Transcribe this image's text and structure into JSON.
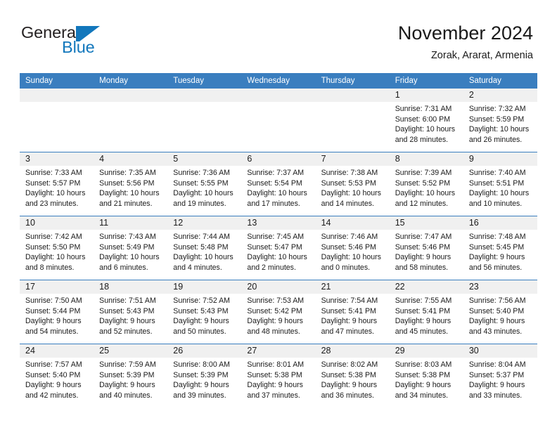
{
  "brand": {
    "name_part1": "General",
    "name_part2": "Blue",
    "accent_color": "#1277bc"
  },
  "header": {
    "title": "November 2024",
    "subtitle": "Zorak, Ararat, Armenia"
  },
  "theme": {
    "header_blue": "#3a7ebf",
    "date_band_grey": "#f0f0f0",
    "text_color": "#1a1a1a"
  },
  "weekdays": [
    "Sunday",
    "Monday",
    "Tuesday",
    "Wednesday",
    "Thursday",
    "Friday",
    "Saturday"
  ],
  "weeks": [
    [
      {
        "day": "",
        "sunrise": "",
        "sunset": "",
        "daylight_line1": "",
        "daylight_line2": "",
        "empty": true
      },
      {
        "day": "",
        "sunrise": "",
        "sunset": "",
        "daylight_line1": "",
        "daylight_line2": "",
        "empty": true
      },
      {
        "day": "",
        "sunrise": "",
        "sunset": "",
        "daylight_line1": "",
        "daylight_line2": "",
        "empty": true
      },
      {
        "day": "",
        "sunrise": "",
        "sunset": "",
        "daylight_line1": "",
        "daylight_line2": "",
        "empty": true
      },
      {
        "day": "",
        "sunrise": "",
        "sunset": "",
        "daylight_line1": "",
        "daylight_line2": "",
        "empty": true
      },
      {
        "day": "1",
        "sunrise": "Sunrise: 7:31 AM",
        "sunset": "Sunset: 6:00 PM",
        "daylight_line1": "Daylight: 10 hours",
        "daylight_line2": "and 28 minutes.",
        "empty": false
      },
      {
        "day": "2",
        "sunrise": "Sunrise: 7:32 AM",
        "sunset": "Sunset: 5:59 PM",
        "daylight_line1": "Daylight: 10 hours",
        "daylight_line2": "and 26 minutes.",
        "empty": false
      }
    ],
    [
      {
        "day": "3",
        "sunrise": "Sunrise: 7:33 AM",
        "sunset": "Sunset: 5:57 PM",
        "daylight_line1": "Daylight: 10 hours",
        "daylight_line2": "and 23 minutes.",
        "empty": false
      },
      {
        "day": "4",
        "sunrise": "Sunrise: 7:35 AM",
        "sunset": "Sunset: 5:56 PM",
        "daylight_line1": "Daylight: 10 hours",
        "daylight_line2": "and 21 minutes.",
        "empty": false
      },
      {
        "day": "5",
        "sunrise": "Sunrise: 7:36 AM",
        "sunset": "Sunset: 5:55 PM",
        "daylight_line1": "Daylight: 10 hours",
        "daylight_line2": "and 19 minutes.",
        "empty": false
      },
      {
        "day": "6",
        "sunrise": "Sunrise: 7:37 AM",
        "sunset": "Sunset: 5:54 PM",
        "daylight_line1": "Daylight: 10 hours",
        "daylight_line2": "and 17 minutes.",
        "empty": false
      },
      {
        "day": "7",
        "sunrise": "Sunrise: 7:38 AM",
        "sunset": "Sunset: 5:53 PM",
        "daylight_line1": "Daylight: 10 hours",
        "daylight_line2": "and 14 minutes.",
        "empty": false
      },
      {
        "day": "8",
        "sunrise": "Sunrise: 7:39 AM",
        "sunset": "Sunset: 5:52 PM",
        "daylight_line1": "Daylight: 10 hours",
        "daylight_line2": "and 12 minutes.",
        "empty": false
      },
      {
        "day": "9",
        "sunrise": "Sunrise: 7:40 AM",
        "sunset": "Sunset: 5:51 PM",
        "daylight_line1": "Daylight: 10 hours",
        "daylight_line2": "and 10 minutes.",
        "empty": false
      }
    ],
    [
      {
        "day": "10",
        "sunrise": "Sunrise: 7:42 AM",
        "sunset": "Sunset: 5:50 PM",
        "daylight_line1": "Daylight: 10 hours",
        "daylight_line2": "and 8 minutes.",
        "empty": false
      },
      {
        "day": "11",
        "sunrise": "Sunrise: 7:43 AM",
        "sunset": "Sunset: 5:49 PM",
        "daylight_line1": "Daylight: 10 hours",
        "daylight_line2": "and 6 minutes.",
        "empty": false
      },
      {
        "day": "12",
        "sunrise": "Sunrise: 7:44 AM",
        "sunset": "Sunset: 5:48 PM",
        "daylight_line1": "Daylight: 10 hours",
        "daylight_line2": "and 4 minutes.",
        "empty": false
      },
      {
        "day": "13",
        "sunrise": "Sunrise: 7:45 AM",
        "sunset": "Sunset: 5:47 PM",
        "daylight_line1": "Daylight: 10 hours",
        "daylight_line2": "and 2 minutes.",
        "empty": false
      },
      {
        "day": "14",
        "sunrise": "Sunrise: 7:46 AM",
        "sunset": "Sunset: 5:46 PM",
        "daylight_line1": "Daylight: 10 hours",
        "daylight_line2": "and 0 minutes.",
        "empty": false
      },
      {
        "day": "15",
        "sunrise": "Sunrise: 7:47 AM",
        "sunset": "Sunset: 5:46 PM",
        "daylight_line1": "Daylight: 9 hours",
        "daylight_line2": "and 58 minutes.",
        "empty": false
      },
      {
        "day": "16",
        "sunrise": "Sunrise: 7:48 AM",
        "sunset": "Sunset: 5:45 PM",
        "daylight_line1": "Daylight: 9 hours",
        "daylight_line2": "and 56 minutes.",
        "empty": false
      }
    ],
    [
      {
        "day": "17",
        "sunrise": "Sunrise: 7:50 AM",
        "sunset": "Sunset: 5:44 PM",
        "daylight_line1": "Daylight: 9 hours",
        "daylight_line2": "and 54 minutes.",
        "empty": false
      },
      {
        "day": "18",
        "sunrise": "Sunrise: 7:51 AM",
        "sunset": "Sunset: 5:43 PM",
        "daylight_line1": "Daylight: 9 hours",
        "daylight_line2": "and 52 minutes.",
        "empty": false
      },
      {
        "day": "19",
        "sunrise": "Sunrise: 7:52 AM",
        "sunset": "Sunset: 5:43 PM",
        "daylight_line1": "Daylight: 9 hours",
        "daylight_line2": "and 50 minutes.",
        "empty": false
      },
      {
        "day": "20",
        "sunrise": "Sunrise: 7:53 AM",
        "sunset": "Sunset: 5:42 PM",
        "daylight_line1": "Daylight: 9 hours",
        "daylight_line2": "and 48 minutes.",
        "empty": false
      },
      {
        "day": "21",
        "sunrise": "Sunrise: 7:54 AM",
        "sunset": "Sunset: 5:41 PM",
        "daylight_line1": "Daylight: 9 hours",
        "daylight_line2": "and 47 minutes.",
        "empty": false
      },
      {
        "day": "22",
        "sunrise": "Sunrise: 7:55 AM",
        "sunset": "Sunset: 5:41 PM",
        "daylight_line1": "Daylight: 9 hours",
        "daylight_line2": "and 45 minutes.",
        "empty": false
      },
      {
        "day": "23",
        "sunrise": "Sunrise: 7:56 AM",
        "sunset": "Sunset: 5:40 PM",
        "daylight_line1": "Daylight: 9 hours",
        "daylight_line2": "and 43 minutes.",
        "empty": false
      }
    ],
    [
      {
        "day": "24",
        "sunrise": "Sunrise: 7:57 AM",
        "sunset": "Sunset: 5:40 PM",
        "daylight_line1": "Daylight: 9 hours",
        "daylight_line2": "and 42 minutes.",
        "empty": false
      },
      {
        "day": "25",
        "sunrise": "Sunrise: 7:59 AM",
        "sunset": "Sunset: 5:39 PM",
        "daylight_line1": "Daylight: 9 hours",
        "daylight_line2": "and 40 minutes.",
        "empty": false
      },
      {
        "day": "26",
        "sunrise": "Sunrise: 8:00 AM",
        "sunset": "Sunset: 5:39 PM",
        "daylight_line1": "Daylight: 9 hours",
        "daylight_line2": "and 39 minutes.",
        "empty": false
      },
      {
        "day": "27",
        "sunrise": "Sunrise: 8:01 AM",
        "sunset": "Sunset: 5:38 PM",
        "daylight_line1": "Daylight: 9 hours",
        "daylight_line2": "and 37 minutes.",
        "empty": false
      },
      {
        "day": "28",
        "sunrise": "Sunrise: 8:02 AM",
        "sunset": "Sunset: 5:38 PM",
        "daylight_line1": "Daylight: 9 hours",
        "daylight_line2": "and 36 minutes.",
        "empty": false
      },
      {
        "day": "29",
        "sunrise": "Sunrise: 8:03 AM",
        "sunset": "Sunset: 5:38 PM",
        "daylight_line1": "Daylight: 9 hours",
        "daylight_line2": "and 34 minutes.",
        "empty": false
      },
      {
        "day": "30",
        "sunrise": "Sunrise: 8:04 AM",
        "sunset": "Sunset: 5:37 PM",
        "daylight_line1": "Daylight: 9 hours",
        "daylight_line2": "and 33 minutes.",
        "empty": false
      }
    ]
  ]
}
